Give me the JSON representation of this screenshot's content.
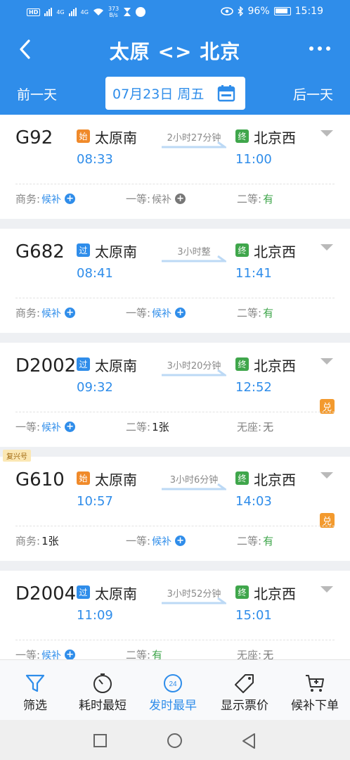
{
  "status": {
    "left": {
      "hd": "HD",
      "net1": "4G",
      "net2": "4G",
      "speed_value": "373",
      "speed_unit": "B/s"
    },
    "right": {
      "battery": "96%",
      "time": "15:19"
    }
  },
  "header": {
    "title": "太原 <> 北京",
    "prev_day": "前一天",
    "next_day": "后一天",
    "date": "07月23日 周五"
  },
  "trains": [
    {
      "number": "G92",
      "badge": "",
      "from_tag": "始",
      "from_tag_type": "start",
      "from": "太原南",
      "depart": "08:33",
      "duration": "2小时27分钟",
      "to_tag": "终",
      "to": "北京西",
      "arrive": "11:00",
      "exchange": "",
      "seats": [
        {
          "label": "商务:",
          "value": "候补",
          "kind": "wait"
        },
        {
          "label": "一等:",
          "value": "候补",
          "kind": "wait-gray"
        },
        {
          "label": "二等:",
          "value": "有",
          "kind": "has"
        }
      ]
    },
    {
      "number": "G682",
      "badge": "",
      "from_tag": "过",
      "from_tag_type": "pass",
      "from": "太原南",
      "depart": "08:41",
      "duration": "3小时整",
      "to_tag": "终",
      "to": "北京西",
      "arrive": "11:41",
      "exchange": "",
      "seats": [
        {
          "label": "商务:",
          "value": "候补",
          "kind": "wait"
        },
        {
          "label": "一等:",
          "value": "候补",
          "kind": "wait"
        },
        {
          "label": "二等:",
          "value": "有",
          "kind": "has"
        }
      ]
    },
    {
      "number": "D2002",
      "badge": "",
      "from_tag": "过",
      "from_tag_type": "pass",
      "from": "太原南",
      "depart": "09:32",
      "duration": "3小时20分钟",
      "to_tag": "终",
      "to": "北京西",
      "arrive": "12:52",
      "exchange": "兑",
      "seats": [
        {
          "label": "一等:",
          "value": "候补",
          "kind": "wait"
        },
        {
          "label": "二等:",
          "value": "1张",
          "kind": "count"
        },
        {
          "label": "无座:",
          "value": "无",
          "kind": "nil"
        }
      ]
    },
    {
      "number": "G610",
      "badge": "复兴号",
      "from_tag": "始",
      "from_tag_type": "start",
      "from": "太原南",
      "depart": "10:57",
      "duration": "3小时6分钟",
      "to_tag": "终",
      "to": "北京西",
      "arrive": "14:03",
      "exchange": "兑",
      "seats": [
        {
          "label": "商务:",
          "value": "1张",
          "kind": "count"
        },
        {
          "label": "一等:",
          "value": "候补",
          "kind": "wait"
        },
        {
          "label": "二等:",
          "value": "有",
          "kind": "has"
        }
      ]
    },
    {
      "number": "D2004",
      "badge": "",
      "from_tag": "过",
      "from_tag_type": "pass",
      "from": "太原南",
      "depart": "11:09",
      "duration": "3小时52分钟",
      "to_tag": "终",
      "to": "北京西",
      "arrive": "15:01",
      "exchange": "",
      "seats": [
        {
          "label": "一等:",
          "value": "候补",
          "kind": "wait"
        },
        {
          "label": "二等:",
          "value": "有",
          "kind": "has"
        },
        {
          "label": "无座:",
          "value": "无",
          "kind": "nil"
        }
      ]
    }
  ],
  "toolbar": [
    {
      "label": "筛选",
      "icon": "filter-icon",
      "active": true,
      "badge": ""
    },
    {
      "label": "耗时最短",
      "icon": "stopwatch-icon",
      "active": false,
      "badge": ""
    },
    {
      "label": "发时最早",
      "icon": "clock-24-icon",
      "active": true,
      "badge": "24"
    },
    {
      "label": "显示票价",
      "icon": "price-tag-icon",
      "active": false,
      "badge": ""
    },
    {
      "label": "候补下单",
      "icon": "cart-icon",
      "active": false,
      "badge": ""
    }
  ],
  "colors": {
    "primary": "#2f8dea",
    "green": "#3fa64b",
    "orange": "#f08a2a"
  }
}
